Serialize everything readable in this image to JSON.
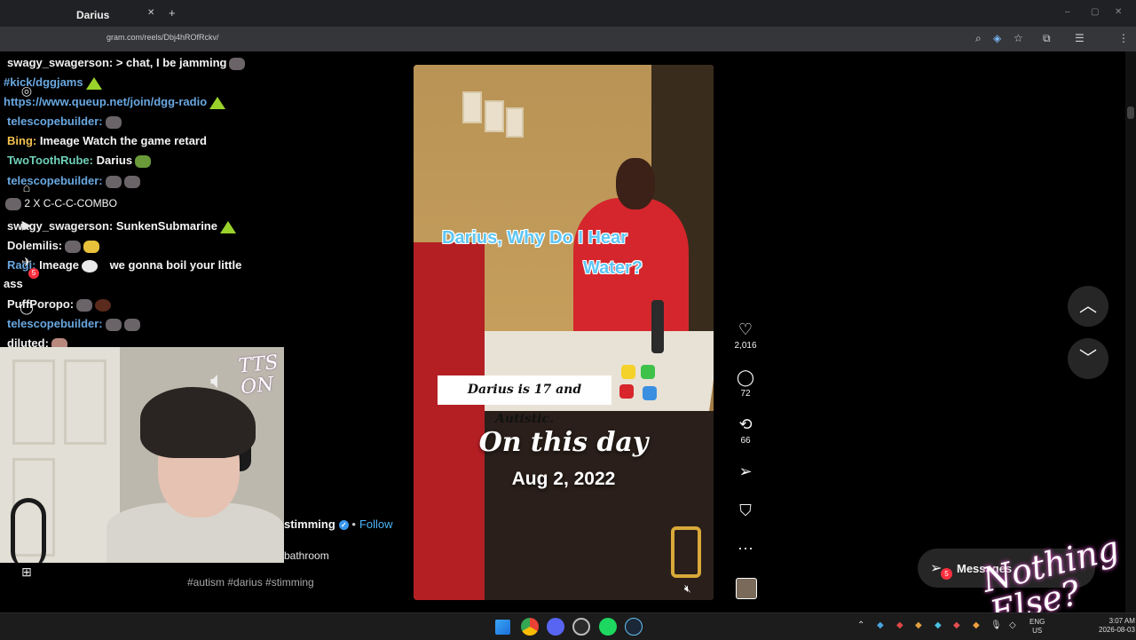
{
  "browser": {
    "tab_title": "Darius",
    "url": "gram.com/reels/Dbj4hROfRckv/",
    "new_tab": "+",
    "tab_close": "✕"
  },
  "chat": {
    "lines": [
      {
        "user": "diluted:",
        "text": "Darius",
        "user_color": "#f0f0f0"
      },
      {
        "user": "Ragi:",
        "text": "Imeage",
        "user_color": "#69a7e0"
      },
      {
        "user": "swagy_swagerson:",
        "text": "> chat, I be jamming",
        "user_color": "#f0f0f0"
      },
      {
        "user": "",
        "text": "#kick/dggjams",
        "user_color": "#69a7e0"
      },
      {
        "user": "",
        "text": "https://www.queup.net/join/dgg-radio",
        "user_color": "#69a7e0"
      },
      {
        "user": "telescopebuilder:",
        "text": "",
        "user_color": "#69a7e0"
      },
      {
        "user": "Bing:",
        "text": "Imeage Watch the game retard",
        "user_color": "#f2c14e"
      },
      {
        "user": "TwoToothRube:",
        "text": "Darius",
        "user_color": "#6fd0b6"
      },
      {
        "user": "telescopebuilder:",
        "text": "",
        "user_color": "#69a7e0"
      },
      {
        "user": "",
        "text": "2 X C-C-C-COMBO",
        "user_color": "#f0f0f0"
      },
      {
        "user": "swagy_swagerson:",
        "text": "SunkenSubmarine",
        "user_color": "#f0f0f0"
      },
      {
        "user": "Dolemilis:",
        "text": "",
        "user_color": "#f0f0f0"
      },
      {
        "user": "Ragi:",
        "text": "Imeage",
        "user_color": "#69a7e0"
      },
      {
        "user": "",
        "text": "we gonna boil your little",
        "user_color": "#f0f0f0"
      },
      {
        "user": "",
        "text": "ass",
        "user_color": "#f0f0f0"
      },
      {
        "user": "PuffPoropo:",
        "text": "",
        "user_color": "#f0f0f0"
      },
      {
        "user": "telescopebuilder:",
        "text": "",
        "user_color": "#69a7e0"
      },
      {
        "user": "diluted:",
        "text": "",
        "user_color": "#f0f0f0"
      }
    ]
  },
  "instagram": {
    "messages_badge": "5",
    "post": {
      "author": "stimming",
      "separator": "•",
      "follow": "Follow",
      "caption": "bathroom",
      "hashtags": "#autism #darius #stimming"
    },
    "reel": {
      "overlay_line1": "Darius, Why Do I Hear",
      "overlay_line2": "Water?",
      "autistic_label": "Darius is 17 and Autistic.",
      "on_this_day": "On this day",
      "date": "Aug 2, 2022"
    },
    "actions": {
      "likes": "2,016",
      "comments": "72",
      "reposts": "66"
    },
    "messages_label": "Messages",
    "messages_count": "5"
  },
  "stream_overlay": {
    "tts_text": "TTS ON",
    "watermark": "Nothing Else?"
  },
  "taskbar": {
    "lang_top": "ENG",
    "lang_bottom": "US",
    "time": "3:07 AM",
    "date": "2026-08-03"
  },
  "colors": {
    "page_bg": "#000000",
    "accent_blue": "#4cb5f9",
    "notification_red": "#ff3040",
    "overlay_text_blue": "#5fc6f5"
  },
  "icons": {
    "like": "heart-icon",
    "comment": "comment-icon",
    "repost": "repost-icon",
    "share": "send-icon",
    "save": "bookmark-icon",
    "more": "more-icon",
    "prev": "chevron-up-icon",
    "next": "chevron-down-icon"
  }
}
